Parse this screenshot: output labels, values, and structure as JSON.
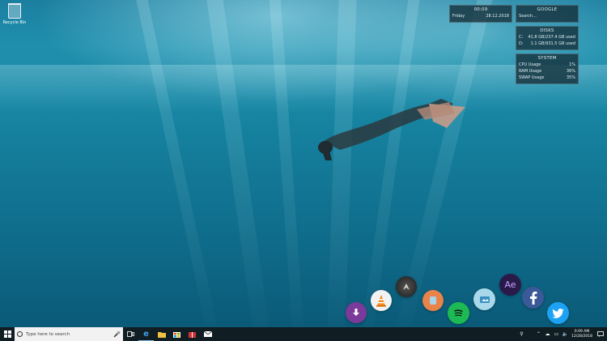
{
  "desktop": {
    "recycle_bin_label": "Recycle Bin"
  },
  "widgets": {
    "clock": {
      "time": "00:09",
      "day": "Friday",
      "date": "28.12.2018"
    },
    "google": {
      "title": "GOOGLE",
      "placeholder": "Search..."
    },
    "disks": {
      "title": "DISKS",
      "rows": [
        {
          "drive": "C:",
          "value": "41.8 GB/237.4 GB used"
        },
        {
          "drive": "D:",
          "value": "1.1 GB/931.5 GB used"
        }
      ]
    },
    "system": {
      "title": "SYSTEM",
      "rows": [
        {
          "label": "CPU Usage",
          "value": "1%"
        },
        {
          "label": "RAM Usage",
          "value": "36%"
        },
        {
          "label": "SWAP Usage",
          "value": "35%"
        }
      ]
    }
  },
  "dock": {
    "ae_label": "Ae"
  },
  "taskbar": {
    "search_placeholder": "Type here to search",
    "time": "0:09 AM",
    "date": "12/28/2018"
  },
  "colors": {
    "download": "#7b3a9a",
    "vlc": "#f28a1e",
    "app_orange": "#e8844a",
    "spotify": "#1db954",
    "facebook": "#3b5998",
    "twitter": "#1da1f2",
    "after_effects": "#2a1a4a",
    "taskbar": "#101d23"
  }
}
